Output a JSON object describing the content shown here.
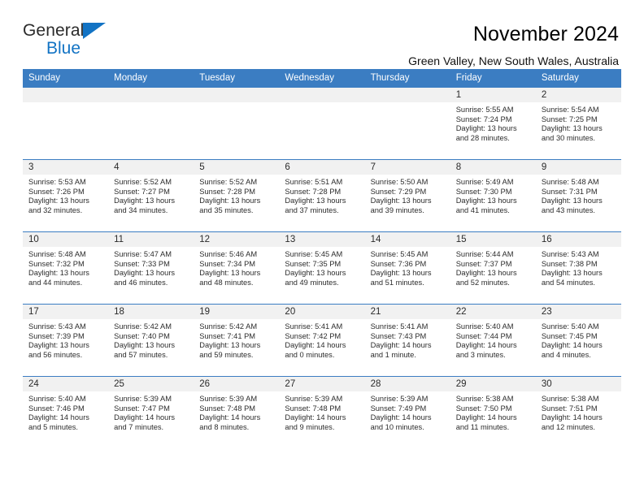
{
  "brand": {
    "name_top": "General",
    "name_bottom": "Blue",
    "accent_color": "#1273c4",
    "triangle_icon": "triangle-icon"
  },
  "header": {
    "title": "November 2024",
    "subtitle": "Green Valley, New South Wales, Australia"
  },
  "calendar": {
    "header_bg": "#3b7dc2",
    "daynum_bg": "#f1f1f1",
    "columns": [
      "Sunday",
      "Monday",
      "Tuesday",
      "Wednesday",
      "Thursday",
      "Friday",
      "Saturday"
    ],
    "labels": {
      "sunrise": "Sunrise:",
      "sunset": "Sunset:",
      "daylight": "Daylight:"
    },
    "weeks": [
      [
        {
          "day": ""
        },
        {
          "day": ""
        },
        {
          "day": ""
        },
        {
          "day": ""
        },
        {
          "day": ""
        },
        {
          "day": "1",
          "sunrise": "Sunrise: 5:55 AM",
          "sunset": "Sunset: 7:24 PM",
          "daylight": "Daylight: 13 hours and 28 minutes."
        },
        {
          "day": "2",
          "sunrise": "Sunrise: 5:54 AM",
          "sunset": "Sunset: 7:25 PM",
          "daylight": "Daylight: 13 hours and 30 minutes."
        }
      ],
      [
        {
          "day": "3",
          "sunrise": "Sunrise: 5:53 AM",
          "sunset": "Sunset: 7:26 PM",
          "daylight": "Daylight: 13 hours and 32 minutes."
        },
        {
          "day": "4",
          "sunrise": "Sunrise: 5:52 AM",
          "sunset": "Sunset: 7:27 PM",
          "daylight": "Daylight: 13 hours and 34 minutes."
        },
        {
          "day": "5",
          "sunrise": "Sunrise: 5:52 AM",
          "sunset": "Sunset: 7:28 PM",
          "daylight": "Daylight: 13 hours and 35 minutes."
        },
        {
          "day": "6",
          "sunrise": "Sunrise: 5:51 AM",
          "sunset": "Sunset: 7:28 PM",
          "daylight": "Daylight: 13 hours and 37 minutes."
        },
        {
          "day": "7",
          "sunrise": "Sunrise: 5:50 AM",
          "sunset": "Sunset: 7:29 PM",
          "daylight": "Daylight: 13 hours and 39 minutes."
        },
        {
          "day": "8",
          "sunrise": "Sunrise: 5:49 AM",
          "sunset": "Sunset: 7:30 PM",
          "daylight": "Daylight: 13 hours and 41 minutes."
        },
        {
          "day": "9",
          "sunrise": "Sunrise: 5:48 AM",
          "sunset": "Sunset: 7:31 PM",
          "daylight": "Daylight: 13 hours and 43 minutes."
        }
      ],
      [
        {
          "day": "10",
          "sunrise": "Sunrise: 5:48 AM",
          "sunset": "Sunset: 7:32 PM",
          "daylight": "Daylight: 13 hours and 44 minutes."
        },
        {
          "day": "11",
          "sunrise": "Sunrise: 5:47 AM",
          "sunset": "Sunset: 7:33 PM",
          "daylight": "Daylight: 13 hours and 46 minutes."
        },
        {
          "day": "12",
          "sunrise": "Sunrise: 5:46 AM",
          "sunset": "Sunset: 7:34 PM",
          "daylight": "Daylight: 13 hours and 48 minutes."
        },
        {
          "day": "13",
          "sunrise": "Sunrise: 5:45 AM",
          "sunset": "Sunset: 7:35 PM",
          "daylight": "Daylight: 13 hours and 49 minutes."
        },
        {
          "day": "14",
          "sunrise": "Sunrise: 5:45 AM",
          "sunset": "Sunset: 7:36 PM",
          "daylight": "Daylight: 13 hours and 51 minutes."
        },
        {
          "day": "15",
          "sunrise": "Sunrise: 5:44 AM",
          "sunset": "Sunset: 7:37 PM",
          "daylight": "Daylight: 13 hours and 52 minutes."
        },
        {
          "day": "16",
          "sunrise": "Sunrise: 5:43 AM",
          "sunset": "Sunset: 7:38 PM",
          "daylight": "Daylight: 13 hours and 54 minutes."
        }
      ],
      [
        {
          "day": "17",
          "sunrise": "Sunrise: 5:43 AM",
          "sunset": "Sunset: 7:39 PM",
          "daylight": "Daylight: 13 hours and 56 minutes."
        },
        {
          "day": "18",
          "sunrise": "Sunrise: 5:42 AM",
          "sunset": "Sunset: 7:40 PM",
          "daylight": "Daylight: 13 hours and 57 minutes."
        },
        {
          "day": "19",
          "sunrise": "Sunrise: 5:42 AM",
          "sunset": "Sunset: 7:41 PM",
          "daylight": "Daylight: 13 hours and 59 minutes."
        },
        {
          "day": "20",
          "sunrise": "Sunrise: 5:41 AM",
          "sunset": "Sunset: 7:42 PM",
          "daylight": "Daylight: 14 hours and 0 minutes."
        },
        {
          "day": "21",
          "sunrise": "Sunrise: 5:41 AM",
          "sunset": "Sunset: 7:43 PM",
          "daylight": "Daylight: 14 hours and 1 minute."
        },
        {
          "day": "22",
          "sunrise": "Sunrise: 5:40 AM",
          "sunset": "Sunset: 7:44 PM",
          "daylight": "Daylight: 14 hours and 3 minutes."
        },
        {
          "day": "23",
          "sunrise": "Sunrise: 5:40 AM",
          "sunset": "Sunset: 7:45 PM",
          "daylight": "Daylight: 14 hours and 4 minutes."
        }
      ],
      [
        {
          "day": "24",
          "sunrise": "Sunrise: 5:40 AM",
          "sunset": "Sunset: 7:46 PM",
          "daylight": "Daylight: 14 hours and 5 minutes."
        },
        {
          "day": "25",
          "sunrise": "Sunrise: 5:39 AM",
          "sunset": "Sunset: 7:47 PM",
          "daylight": "Daylight: 14 hours and 7 minutes."
        },
        {
          "day": "26",
          "sunrise": "Sunrise: 5:39 AM",
          "sunset": "Sunset: 7:48 PM",
          "daylight": "Daylight: 14 hours and 8 minutes."
        },
        {
          "day": "27",
          "sunrise": "Sunrise: 5:39 AM",
          "sunset": "Sunset: 7:48 PM",
          "daylight": "Daylight: 14 hours and 9 minutes."
        },
        {
          "day": "28",
          "sunrise": "Sunrise: 5:39 AM",
          "sunset": "Sunset: 7:49 PM",
          "daylight": "Daylight: 14 hours and 10 minutes."
        },
        {
          "day": "29",
          "sunrise": "Sunrise: 5:38 AM",
          "sunset": "Sunset: 7:50 PM",
          "daylight": "Daylight: 14 hours and 11 minutes."
        },
        {
          "day": "30",
          "sunrise": "Sunrise: 5:38 AM",
          "sunset": "Sunset: 7:51 PM",
          "daylight": "Daylight: 14 hours and 12 minutes."
        }
      ]
    ]
  }
}
